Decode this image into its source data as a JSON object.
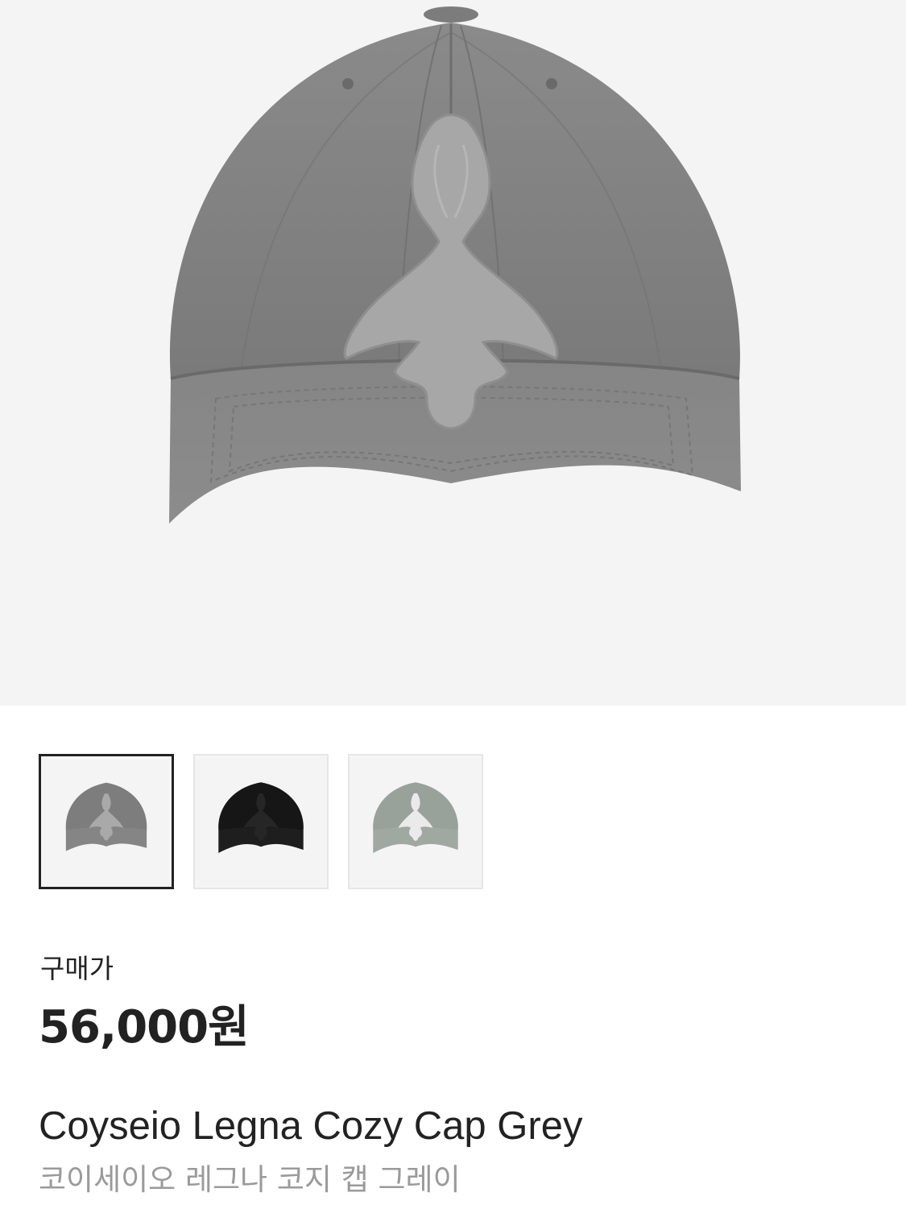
{
  "product": {
    "price_label": "구매가",
    "price": "56,000원",
    "name_en": "Coyseio Legna Cozy Cap Grey",
    "name_ko": "코이세이오 레그나 코지 캡 그레이"
  },
  "gallery": {
    "main_image": "grey-cap-photo",
    "thumbnails": [
      {
        "icon": "grey-cap-photo",
        "color": "#7d7d7d",
        "selected": true
      },
      {
        "icon": "black-cap-photo",
        "color": "#161616",
        "selected": false
      },
      {
        "icon": "sage-cap-photo",
        "color": "#9aa39c",
        "selected": false
      }
    ]
  },
  "colors": {
    "hero_bg": "#f4f4f4",
    "text": "#222222",
    "subtext": "#9a9a9a"
  }
}
